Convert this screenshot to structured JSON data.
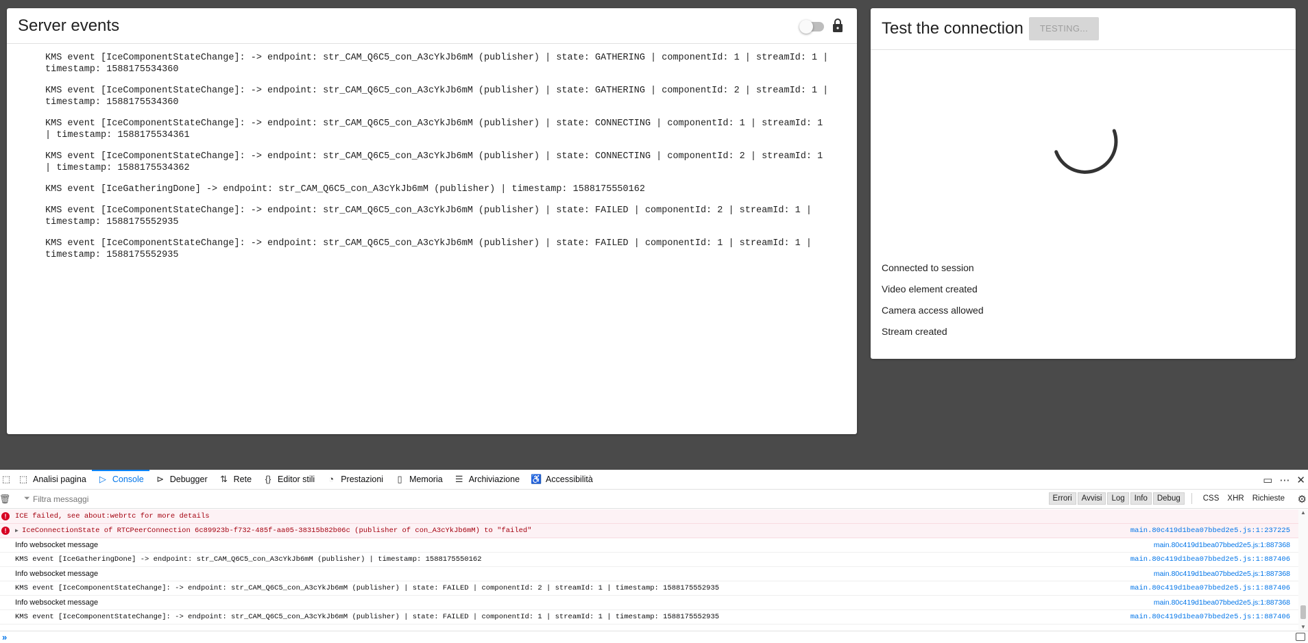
{
  "server_events": {
    "title": "Server events",
    "events": [
      "KMS event [IceComponentStateChange]: -> endpoint: str_CAM_Q6C5_con_A3cYkJb6mM (publisher) | state: GATHERING | componentId: 1 | streamId: 1 | timestamp: 1588175534360",
      "KMS event [IceComponentStateChange]: -> endpoint: str_CAM_Q6C5_con_A3cYkJb6mM (publisher) | state: GATHERING | componentId: 2 | streamId: 1 | timestamp: 1588175534360",
      "KMS event [IceComponentStateChange]: -> endpoint: str_CAM_Q6C5_con_A3cYkJb6mM (publisher) | state: CONNECTING | componentId: 1 | streamId: 1 | timestamp: 1588175534361",
      "KMS event [IceComponentStateChange]: -> endpoint: str_CAM_Q6C5_con_A3cYkJb6mM (publisher) | state: CONNECTING | componentId: 2 | streamId: 1 | timestamp: 1588175534362",
      "KMS event [IceGatheringDone] -> endpoint: str_CAM_Q6C5_con_A3cYkJb6mM (publisher) | timestamp: 1588175550162",
      "KMS event [IceComponentStateChange]: -> endpoint: str_CAM_Q6C5_con_A3cYkJb6mM (publisher) | state: FAILED | componentId: 2 | streamId: 1 | timestamp: 1588175552935",
      "KMS event [IceComponentStateChange]: -> endpoint: str_CAM_Q6C5_con_A3cYkJb6mM (publisher) | state: FAILED | componentId: 1 | streamId: 1 | timestamp: 1588175552935"
    ]
  },
  "test_connection": {
    "title": "Test the connection",
    "button_label": "TESTING...",
    "statuses": [
      "Connected to session",
      "Video element created",
      "Camera access allowed",
      "Stream created"
    ]
  },
  "devtools": {
    "tabs": [
      {
        "label": "Analisi pagina",
        "icon": "inspector-icon"
      },
      {
        "label": "Console",
        "icon": "console-icon",
        "active": true
      },
      {
        "label": "Debugger",
        "icon": "debugger-icon"
      },
      {
        "label": "Rete",
        "icon": "network-icon"
      },
      {
        "label": "Editor stili",
        "icon": "style-editor-icon"
      },
      {
        "label": "Prestazioni",
        "icon": "performance-icon"
      },
      {
        "label": "Memoria",
        "icon": "memory-icon"
      },
      {
        "label": "Archiviazione",
        "icon": "storage-icon"
      },
      {
        "label": "Accessibilità",
        "icon": "accessibility-icon"
      }
    ],
    "filter_placeholder": "Filtra messaggi",
    "levels": [
      "Errori",
      "Avvisi",
      "Log",
      "Info",
      "Debug"
    ],
    "net_filters": [
      "CSS",
      "XHR",
      "Richieste"
    ],
    "messages": [
      {
        "type": "error",
        "text": "ICE failed, see about:webrtc for more details",
        "source": ""
      },
      {
        "type": "error",
        "expandable": true,
        "text": "IceConnectionState of RTCPeerConnection 6c89923b-f732-485f-aa05-38315b82b06c (publisher of con_A3cYkJb6mM) to \"failed\"",
        "source": "main.80c419d1bea07bbed2e5.js:1:237225"
      },
      {
        "type": "log",
        "text": "Info websocket message",
        "source": "main.80c419d1bea07bbed2e5.js:1:887368"
      },
      {
        "type": "log",
        "text": "KMS event [IceGatheringDone] -> endpoint: str_CAM_Q6C5_con_A3cYkJb6mM (publisher) | timestamp: 1588175550162",
        "source": "main.80c419d1bea07bbed2e5.js:1:887406"
      },
      {
        "type": "log",
        "text": "Info websocket message",
        "source": "main.80c419d1bea07bbed2e5.js:1:887368"
      },
      {
        "type": "log",
        "text": "KMS event [IceComponentStateChange]: -> endpoint: str_CAM_Q6C5_con_A3cYkJb6mM (publisher) | state: FAILED | componentId: 2 | streamId: 1 | timestamp: 1588175552935",
        "source": "main.80c419d1bea07bbed2e5.js:1:887406"
      },
      {
        "type": "log",
        "text": "Info websocket message",
        "source": "main.80c419d1bea07bbed2e5.js:1:887368"
      },
      {
        "type": "log",
        "text": "KMS event [IceComponentStateChange]: -> endpoint: str_CAM_Q6C5_con_A3cYkJb6mM (publisher) | state: FAILED | componentId: 1 | streamId: 1 | timestamp: 1588175552935",
        "source": "main.80c419d1bea07bbed2e5.js:1:887406"
      }
    ]
  }
}
